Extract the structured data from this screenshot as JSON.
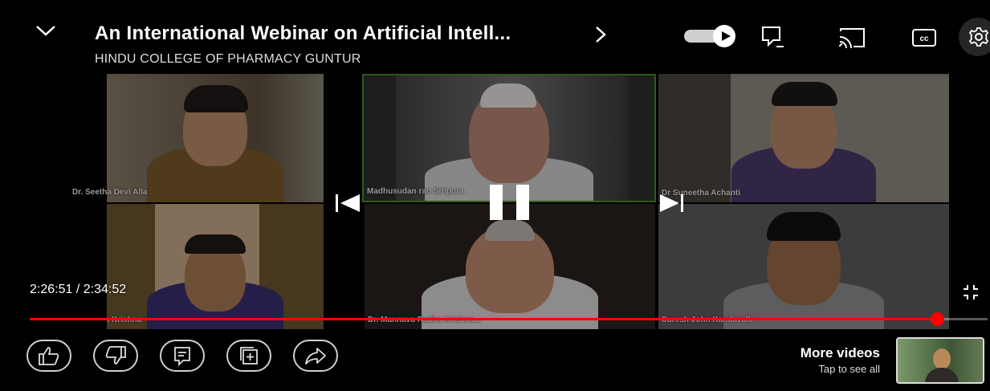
{
  "video": {
    "title": "An International Webinar on Artificial Intell...",
    "title_more_icon": "chevron-right-icon",
    "channel": "HINDU COLLEGE OF PHARMACY GUNTUR"
  },
  "participants": [
    {
      "name": "Dr. Seetha Devi Alla"
    },
    {
      "name": "Madhusudan rao Siripura"
    },
    {
      "name": "Dr Suneetha Achanti"
    },
    {
      "name": "Sreevidya Krishna"
    },
    {
      "name": "Dr. Mannava Radha Krishna..."
    },
    {
      "name": "Suresh John Kandavalli"
    }
  ],
  "top_icons": [
    "collapse-chevron-icon",
    "autoplay-toggle-icon",
    "playlist-icon",
    "cast-icon",
    "captions-icon",
    "settings-icon"
  ],
  "player": {
    "current_time": "2:26:51",
    "separator": "/",
    "duration": "2:34:52",
    "progress_fraction": 0.947,
    "state": "playing",
    "accent_color": "#ff0000"
  },
  "actions": [
    "like-icon",
    "dislike-icon",
    "comments-icon",
    "save-to-playlist-icon",
    "share-icon"
  ],
  "more_videos": {
    "title": "More videos",
    "subtitle": "Tap to see all"
  }
}
